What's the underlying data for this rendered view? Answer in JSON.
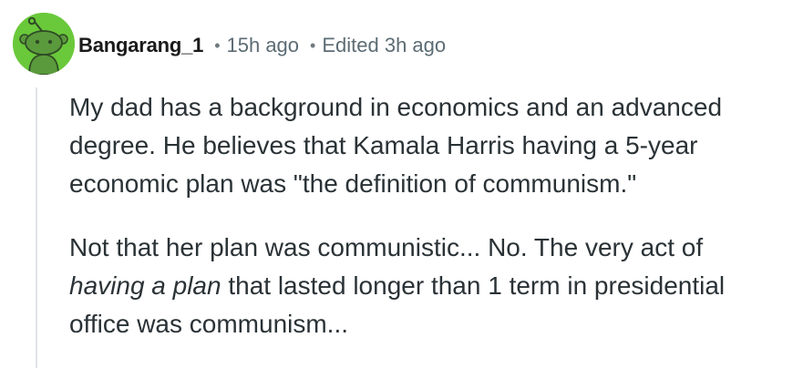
{
  "comment": {
    "author": "Bangarang_1",
    "separator": "•",
    "posted_time": "15h ago",
    "edited_time": "Edited 3h ago",
    "avatar_icon": "snoo-avatar-icon",
    "avatar_color": "#6ac93a",
    "paragraph_1": {
      "line_1": "My dad has a background in economics and an advanced",
      "line_2": "degree. He believes that Kamala Harris having a 5-year",
      "line_3": "economic plan was \"the definition of communism.\""
    },
    "paragraph_2": {
      "line_1": "Not that her plan was communistic... No. The very act of",
      "line_2_emphasis": "having a plan",
      "line_2_rest": " that lasted longer than 1 term in presidential",
      "line_3": "office was communism..."
    }
  }
}
